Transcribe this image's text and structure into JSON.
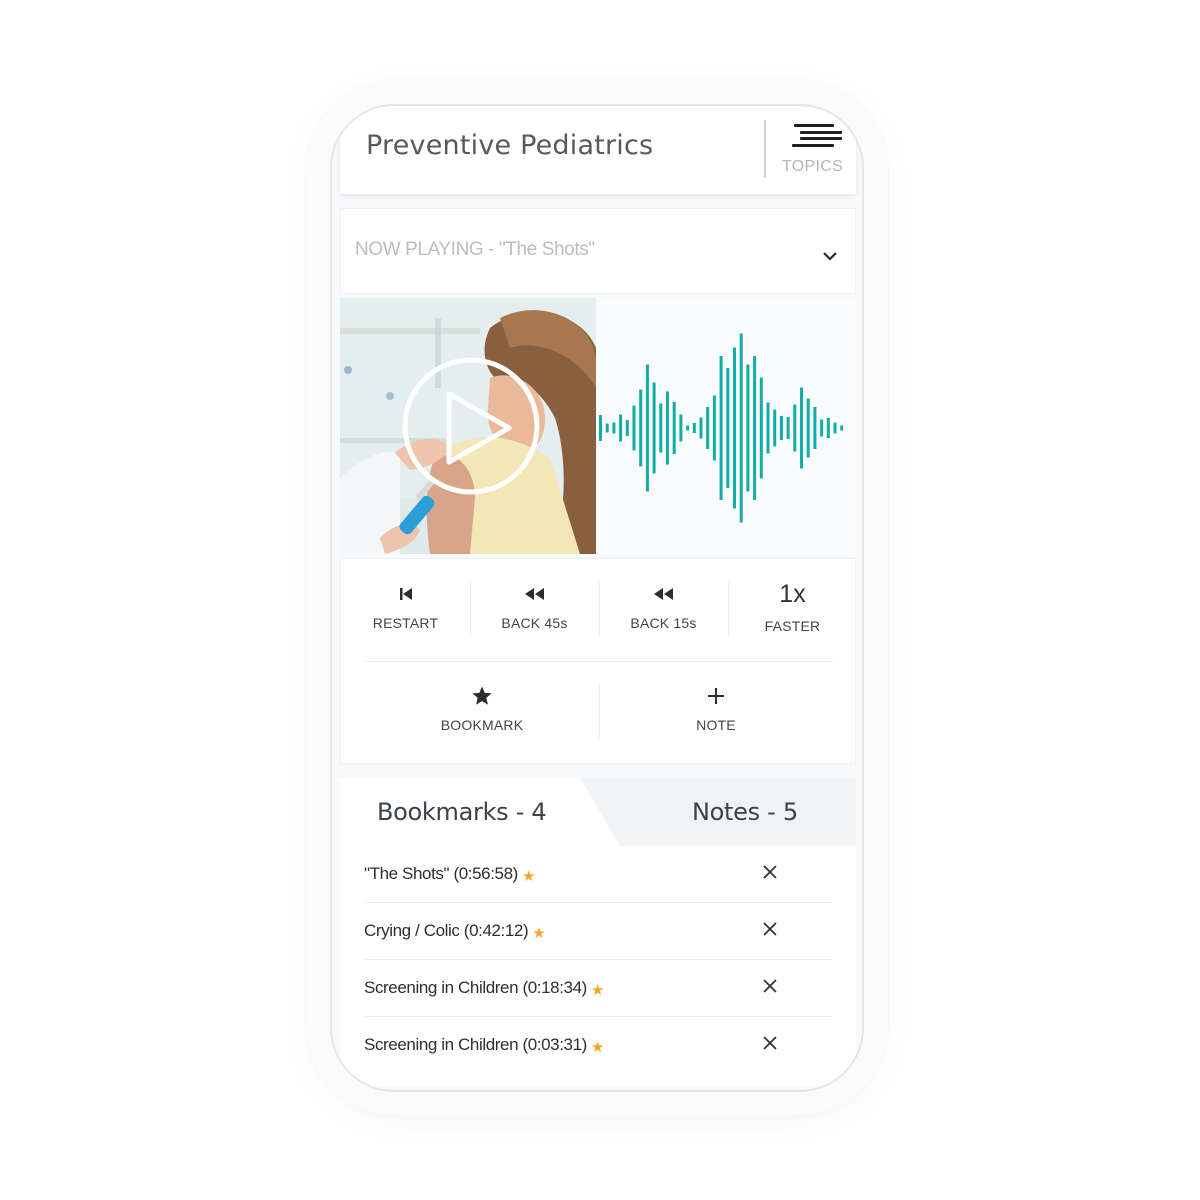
{
  "app": {
    "title": "Preventive Pediatrics",
    "topics_label": "TOPICS",
    "topics_icon": "menu-lines-icon"
  },
  "now_playing": {
    "text": "NOW PLAYING - \"The Shots\"",
    "expand_icon": "chevron-down-icon"
  },
  "media": {
    "thumbnail_alt": "Child receiving a vaccination",
    "play_icon": "play-circle-icon",
    "waveform_color": "#12ada6",
    "waveform_amplitudes": [
      26,
      9,
      11,
      27,
      16,
      45,
      77,
      127,
      91,
      49,
      73,
      52,
      27,
      5,
      10,
      21,
      42,
      65,
      144,
      120,
      161,
      189,
      127,
      144,
      101,
      51,
      37,
      24,
      22,
      47,
      81,
      59,
      42,
      17,
      20,
      11,
      5
    ]
  },
  "controls": {
    "restart": {
      "label": "RESTART",
      "icon": "skip-back-icon"
    },
    "back45": {
      "label": "BACK 45s",
      "icon": "rewind-icon"
    },
    "back15": {
      "label": "BACK 15s",
      "icon": "rewind-icon"
    },
    "speed": {
      "value": "1x",
      "label": "FASTER"
    },
    "bookmark": {
      "label": "BOOKMARK",
      "icon": "star-icon"
    },
    "note": {
      "label": "NOTE",
      "icon": "plus-icon"
    }
  },
  "tabs": {
    "bookmarks": "Bookmarks - 4",
    "notes": "Notes - 5",
    "active": "bookmarks"
  },
  "bookmarks": [
    {
      "title": "\"The Shots\" (0:56:58)"
    },
    {
      "title": "Crying / Colic (0:42:12)"
    },
    {
      "title": "Screening in Children (0:18:34)"
    },
    {
      "title": "Screening in Children (0:03:31)"
    }
  ],
  "colors": {
    "accent_teal": "#12ada6",
    "star_orange": "#f6a623"
  }
}
